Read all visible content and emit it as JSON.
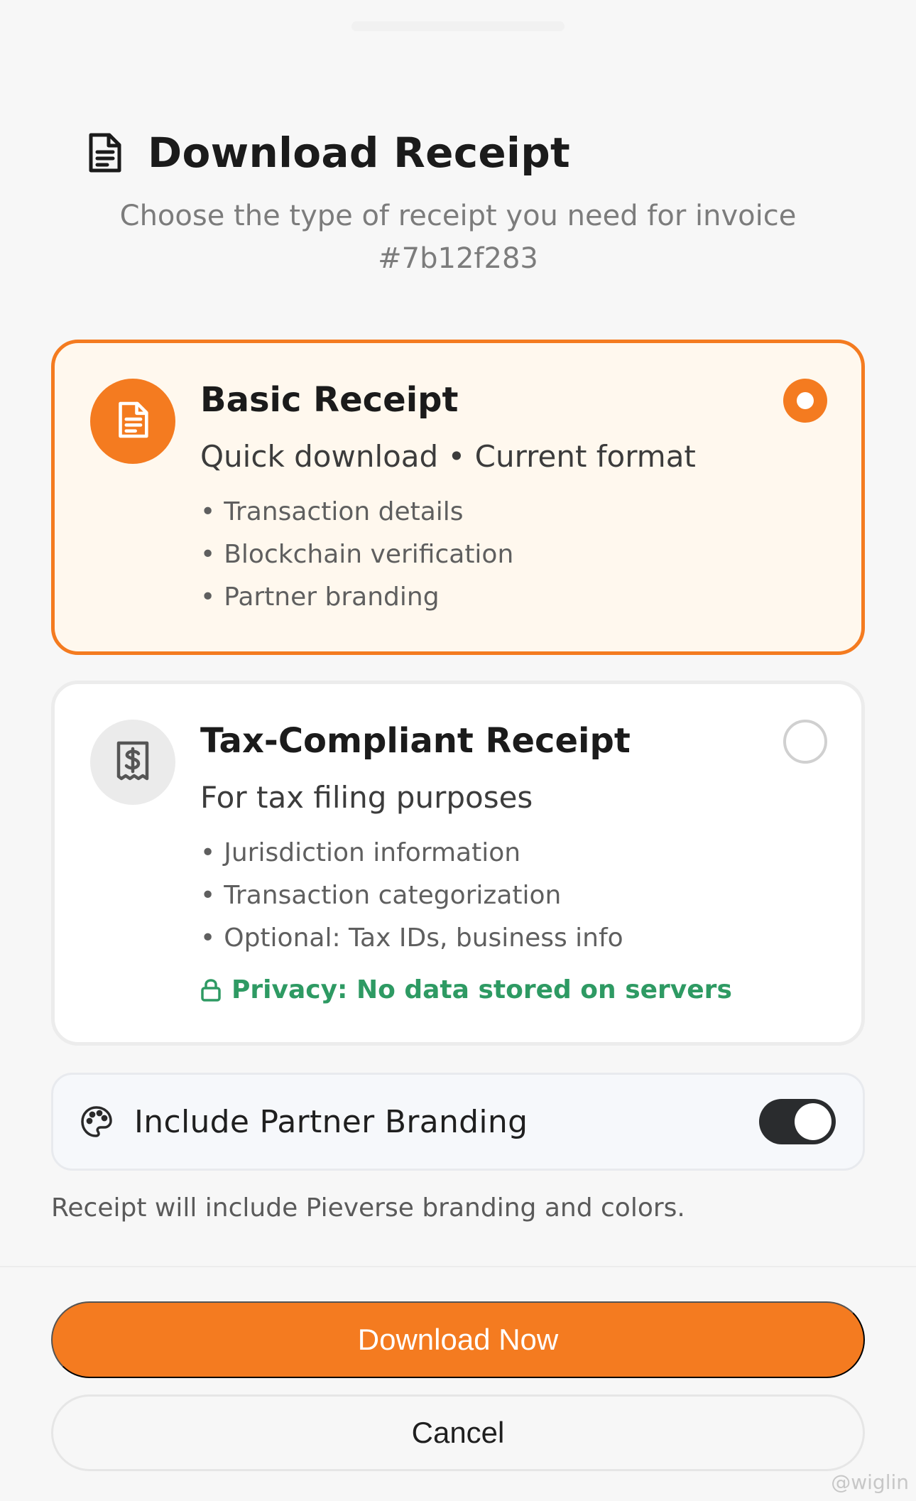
{
  "header": {
    "title": "Download Receipt",
    "subtitle": "Choose the type of receipt you need for invoice #7b12f283"
  },
  "options": [
    {
      "title": "Basic Receipt",
      "subtitle": "Quick download • Current format",
      "features": [
        "Transaction details",
        "Blockchain verification",
        "Partner branding"
      ],
      "selected": true,
      "icon": "document-icon"
    },
    {
      "title": "Tax-Compliant Receipt",
      "subtitle": "For tax filing purposes",
      "features": [
        "Jurisdiction information",
        "Transaction categorization",
        "Optional: Tax IDs, business info"
      ],
      "privacy": "Privacy: No data stored on servers",
      "selected": false,
      "icon": "receipt-dollar-icon"
    }
  ],
  "branding": {
    "label": "Include Partner Branding",
    "enabled": true,
    "note": "Receipt will include Pieverse branding and colors."
  },
  "actions": {
    "download": "Download Now",
    "cancel": "Cancel"
  },
  "watermark": "@wiglin",
  "colors": {
    "accent": "#f47b20",
    "accent_bg": "#fff8ee",
    "success": "#2e9a63",
    "switch_on": "#2a2c2e"
  }
}
